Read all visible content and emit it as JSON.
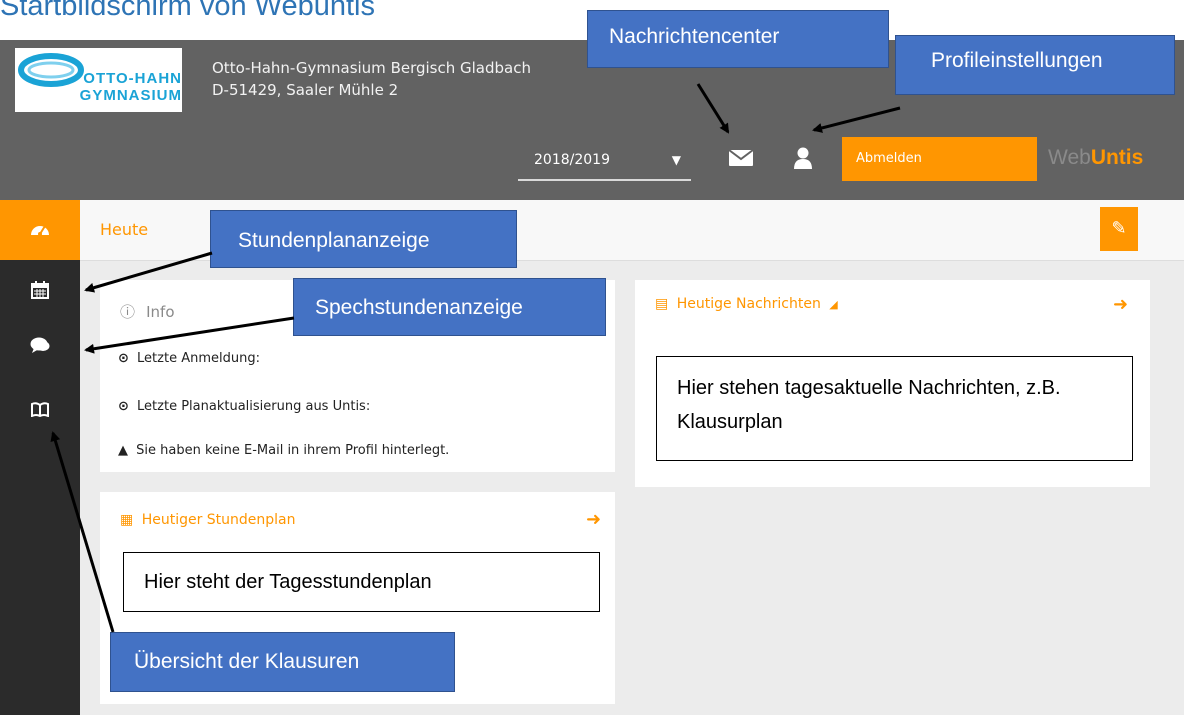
{
  "document": {
    "title": "Startbildschirm von Webuntis"
  },
  "header": {
    "logo_text": "OTTO-HAHN GYMNASIUM",
    "school_name": "Otto-Hahn-Gymnasium Bergisch Gladbach",
    "school_address": "D-51429, Saaler Mühle 2",
    "year_selector": {
      "value": "2018/2019"
    },
    "logout_label": "Abmelden",
    "brand_web": "Web",
    "brand_untis": "Untis"
  },
  "sidebar": {
    "items": [
      {
        "icon": "dashboard-icon",
        "active": true
      },
      {
        "icon": "calendar-icon"
      },
      {
        "icon": "chat-icon"
      },
      {
        "icon": "book-icon"
      }
    ]
  },
  "page": {
    "title": "Heute"
  },
  "info_card": {
    "title": "Info",
    "last_login": "Letzte Anmeldung:",
    "last_update": "Letzte Planaktualisierung aus Untis:",
    "warning": "Sie haben keine E-Mail in ihrem Profil hinterlegt."
  },
  "timetable_card": {
    "title": "Heutiger Stundenplan"
  },
  "news_card": {
    "title": "Heutige Nachrichten"
  },
  "annotations": {
    "nachrichtencenter": "Nachrichtencenter",
    "profileinstellungen": "Profileinstellungen",
    "stundenplananzeige": "Stundenplananzeige",
    "sprechstunden": "Spechstundenanzeige",
    "klausuren": "Übersicht der Klausuren",
    "news_note": "Hier stehen tagesaktuelle Nachrichten, z.B. Klausurplan",
    "timetable_note": "Hier steht der Tagesstundenplan"
  },
  "colors": {
    "accent": "#ff9601",
    "header_bg": "#626262",
    "sidebar_bg": "#2b2b2b",
    "callout_bg": "#4472c4"
  }
}
